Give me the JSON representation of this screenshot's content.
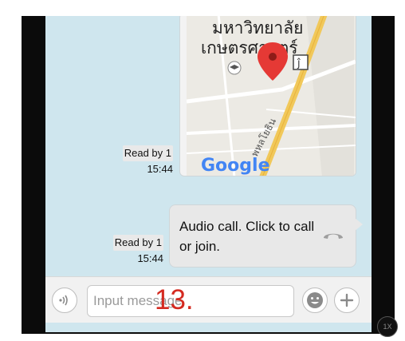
{
  "chat": {
    "map_message": {
      "place_name_line1": "มหาวิทยาลัย",
      "place_name_line2": "เกษตรศาสตร์",
      "road_label": "พหลโยธิน",
      "attribution": "Google",
      "read_status": "Read by 1",
      "time": "15:44"
    },
    "call_message": {
      "text": "Audio call. Click to call or join.",
      "read_status": "Read by 1",
      "time": "15:44"
    }
  },
  "input_bar": {
    "placeholder": "Input message",
    "voice_icon": "voice-wave-icon",
    "emoji_icon": "smiley-icon",
    "plus_icon": "plus-icon"
  },
  "annotation": {
    "step_label": "13."
  },
  "zoom_badge": "1X",
  "colors": {
    "chat_background": "#cfe6ee",
    "bubble": "#e8e8e8",
    "map_pin": "#e53935",
    "step_label": "#d42a20",
    "frame": "#0b0b0b"
  }
}
